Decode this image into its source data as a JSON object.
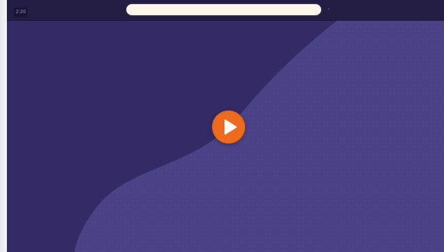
{
  "player": {
    "duration": "2:20",
    "title": "",
    "play_icon": "play-icon"
  },
  "colors": {
    "background_dark": "#332a66",
    "wave_light": "#4a4286",
    "top_bar": "#231d44",
    "title_pill": "#fcf7e8",
    "play_button": "#ee6a1c"
  }
}
